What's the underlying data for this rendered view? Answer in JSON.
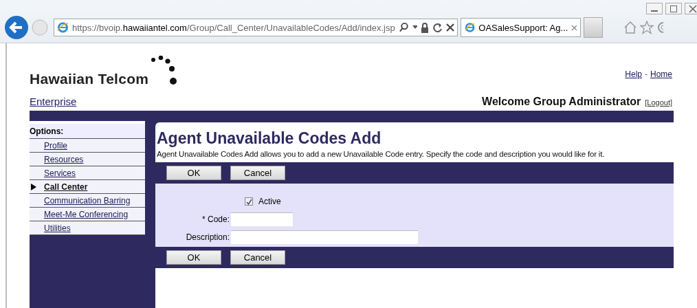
{
  "browser": {
    "url_prefix": "https://bvoip.",
    "url_domain": "hawaiiantel.com",
    "url_path": "/Group/Call_Center/UnavailableCodes/Add/index.jsp",
    "tab_title": "OASalesSupport: Ag..."
  },
  "header": {
    "logo": "Hawaiian Telcom",
    "links": [
      "Help",
      "Home"
    ],
    "separator": "-",
    "section": "Enterprise",
    "welcome": "Welcome Group Administrator",
    "logout": "[Logout]"
  },
  "sidebar": {
    "title": "Options:",
    "items": [
      {
        "label": "Profile",
        "selected": false
      },
      {
        "label": "Resources",
        "selected": false
      },
      {
        "label": "Services",
        "selected": false
      },
      {
        "label": "Call Center",
        "selected": true
      },
      {
        "label": "Communication Barring",
        "selected": false
      },
      {
        "label": "Meet-Me Conferencing",
        "selected": false
      },
      {
        "label": "Utilities",
        "selected": false
      }
    ]
  },
  "page": {
    "title": "Agent Unavailable Codes Add",
    "description": "Agent Unavailable Codes Add allows you to add a new Unavailable Code entry. Specify the code and description you would like for it.",
    "top_buttons": [
      "OK",
      "Cancel"
    ],
    "active": {
      "label": "Active",
      "checked": true
    },
    "fields": [
      {
        "label": "* Code:"
      },
      {
        "label": "Description:"
      }
    ],
    "bottom_buttons": [
      "OK",
      "Cancel"
    ]
  }
}
